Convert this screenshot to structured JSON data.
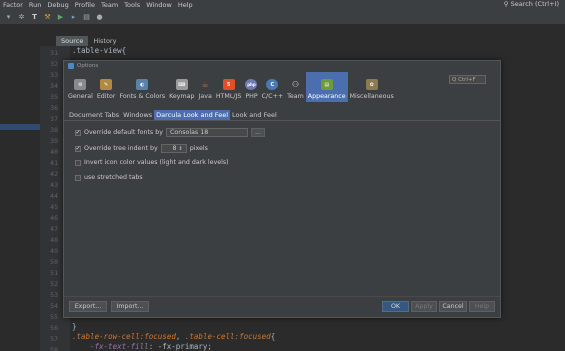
{
  "menubar": {
    "items": [
      "Factor",
      "Run",
      "Debug",
      "Profile",
      "Team",
      "Tools",
      "Window",
      "Help"
    ],
    "search": "Search (Ctrl+I)"
  },
  "editor_tabs": [
    "Source",
    "History"
  ],
  "gutter_lines": [
    "31",
    "32",
    "33",
    "34",
    "35",
    "36",
    "37",
    "38",
    "39",
    "40",
    "41",
    "42",
    "43",
    "44",
    "45",
    "46",
    "47",
    "48",
    "49",
    "50",
    "51",
    "52",
    "53",
    "54",
    "55",
    "56",
    "57",
    "58"
  ],
  "code": {
    "top_line": ".table-view{",
    "line_56": "}",
    "line_57_sel1": ".table-row-cell:focused",
    "line_57_mid": ", ",
    "line_57_sel2": ".table-cell:focused",
    "line_57_end": "{",
    "line_58_prop": "-fx-text-fill",
    "line_58_rest": ": -fx-primary;"
  },
  "dialog": {
    "title": "Options",
    "search_placeholder": "Q Ctrl+F",
    "categories": [
      {
        "label": "General",
        "icon": "general-icon",
        "color": "#a0a0a0"
      },
      {
        "label": "Editor",
        "icon": "editor-icon",
        "color": "#c8a050"
      },
      {
        "label": "Fonts & Colors",
        "icon": "palette-icon",
        "color": "#7aa4c8"
      },
      {
        "label": "Keymap",
        "icon": "keyboard-icon",
        "color": "#c8c8c8"
      },
      {
        "label": "Java",
        "icon": "java-icon",
        "color": "#c86a3c"
      },
      {
        "label": "HTML/JS",
        "icon": "html5-icon",
        "color": "#e44d26"
      },
      {
        "label": "PHP",
        "icon": "php-icon",
        "color": "#8892bf"
      },
      {
        "label": "C/C++",
        "icon": "cpp-icon",
        "color": "#659ad2"
      },
      {
        "label": "Team",
        "icon": "team-icon",
        "color": "#d0d0d0"
      },
      {
        "label": "Appearance",
        "icon": "appearance-icon",
        "color": "#8fc04a"
      },
      {
        "label": "Miscellaneous",
        "icon": "misc-icon",
        "color": "#b0a070"
      }
    ],
    "sub_tabs": [
      "Document Tabs",
      "Windows",
      "Darcula Look and Feel",
      "Look and Feel"
    ],
    "options": {
      "override_fonts_label": "Override default fonts by",
      "override_fonts_checked": true,
      "font_value": "Consolas 18",
      "browse_label": "...",
      "override_indent_label": "Override tree indent by",
      "override_indent_checked": true,
      "indent_value": "8",
      "indent_unit": "pixels",
      "invert_icons_label": "Invert icon color values (light and dark levels)",
      "invert_icons_checked": false,
      "stretched_tabs_label": "use stretched tabs",
      "stretched_tabs_checked": false
    },
    "buttons": {
      "export": "Export...",
      "import": "Import...",
      "ok": "OK",
      "apply": "Apply",
      "cancel": "Cancel",
      "help": "Help"
    }
  },
  "colors": {
    "accent": "#4b6eaf",
    "background": "#2b2b2b",
    "dialog_bg": "#3c3f41"
  }
}
